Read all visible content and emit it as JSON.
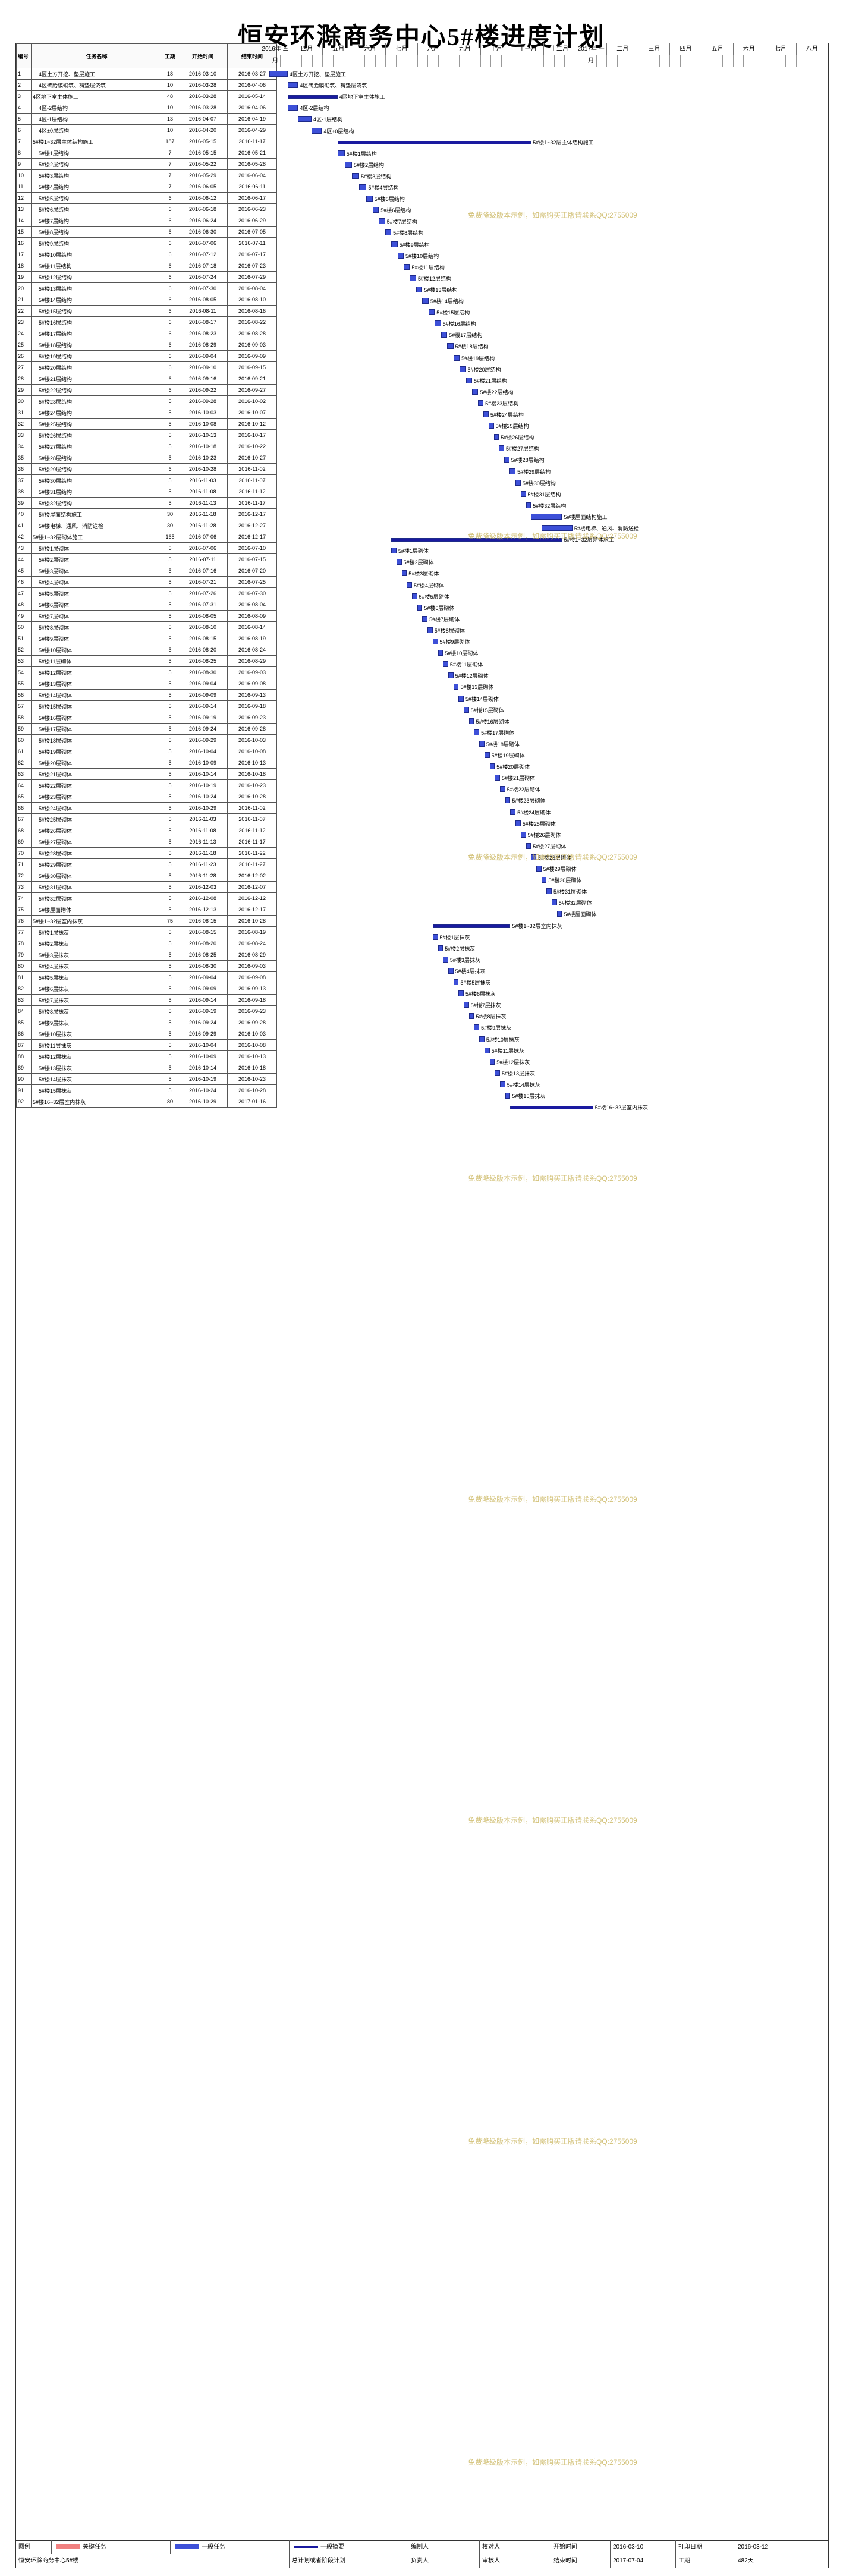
{
  "title": "恒安环滁商务中心5#楼进度计划",
  "table": {
    "headers": [
      "编号",
      "任务名称",
      "工期",
      "开始时间",
      "结束时间"
    ],
    "rows": [
      [
        "1",
        "4区土方开挖、垫层施工",
        "18",
        "2016-03-10",
        "2016-03-27"
      ],
      [
        "2",
        "4区砖胎膜砌筑、褥垫层浇筑",
        "10",
        "2016-03-28",
        "2016-04-06"
      ],
      [
        "3",
        "4区地下室主体施工",
        "48",
        "2016-03-28",
        "2016-05-14"
      ],
      [
        "4",
        "4区-2层结构",
        "10",
        "2016-03-28",
        "2016-04-06"
      ],
      [
        "5",
        "4区-1层结构",
        "13",
        "2016-04-07",
        "2016-04-19"
      ],
      [
        "6",
        "4区±0层结构",
        "10",
        "2016-04-20",
        "2016-04-29"
      ],
      [
        "7",
        "5#楼1~32层主体结构施工",
        "187",
        "2016-05-15",
        "2016-11-17"
      ],
      [
        "8",
        "5#楼1层结构",
        "7",
        "2016-05-15",
        "2016-05-21"
      ],
      [
        "9",
        "5#楼2层结构",
        "7",
        "2016-05-22",
        "2016-05-28"
      ],
      [
        "10",
        "5#楼3层结构",
        "7",
        "2016-05-29",
        "2016-06-04"
      ],
      [
        "11",
        "5#楼4层结构",
        "7",
        "2016-06-05",
        "2016-06-11"
      ],
      [
        "12",
        "5#楼5层结构",
        "6",
        "2016-06-12",
        "2016-06-17"
      ],
      [
        "13",
        "5#楼6层结构",
        "6",
        "2016-06-18",
        "2016-06-23"
      ],
      [
        "14",
        "5#楼7层结构",
        "6",
        "2016-06-24",
        "2016-06-29"
      ],
      [
        "15",
        "5#楼8层结构",
        "6",
        "2016-06-30",
        "2016-07-05"
      ],
      [
        "16",
        "5#楼9层结构",
        "6",
        "2016-07-06",
        "2016-07-11"
      ],
      [
        "17",
        "5#楼10层结构",
        "6",
        "2016-07-12",
        "2016-07-17"
      ],
      [
        "18",
        "5#楼11层结构",
        "6",
        "2016-07-18",
        "2016-07-23"
      ],
      [
        "19",
        "5#楼12层结构",
        "6",
        "2016-07-24",
        "2016-07-29"
      ],
      [
        "20",
        "5#楼13层结构",
        "6",
        "2016-07-30",
        "2016-08-04"
      ],
      [
        "21",
        "5#楼14层结构",
        "6",
        "2016-08-05",
        "2016-08-10"
      ],
      [
        "22",
        "5#楼15层结构",
        "6",
        "2016-08-11",
        "2016-08-16"
      ],
      [
        "23",
        "5#楼16层结构",
        "6",
        "2016-08-17",
        "2016-08-22"
      ],
      [
        "24",
        "5#楼17层结构",
        "6",
        "2016-08-23",
        "2016-08-28"
      ],
      [
        "25",
        "5#楼18层结构",
        "6",
        "2016-08-29",
        "2016-09-03"
      ],
      [
        "26",
        "5#楼19层结构",
        "6",
        "2016-09-04",
        "2016-09-09"
      ],
      [
        "27",
        "5#楼20层结构",
        "6",
        "2016-09-10",
        "2016-09-15"
      ],
      [
        "28",
        "5#楼21层结构",
        "6",
        "2016-09-16",
        "2016-09-21"
      ],
      [
        "29",
        "5#楼22层结构",
        "6",
        "2016-09-22",
        "2016-09-27"
      ],
      [
        "30",
        "5#楼23层结构",
        "5",
        "2016-09-28",
        "2016-10-02"
      ],
      [
        "31",
        "5#楼24层结构",
        "5",
        "2016-10-03",
        "2016-10-07"
      ],
      [
        "32",
        "5#楼25层结构",
        "5",
        "2016-10-08",
        "2016-10-12"
      ],
      [
        "33",
        "5#楼26层结构",
        "5",
        "2016-10-13",
        "2016-10-17"
      ],
      [
        "34",
        "5#楼27层结构",
        "5",
        "2016-10-18",
        "2016-10-22"
      ],
      [
        "35",
        "5#楼28层结构",
        "5",
        "2016-10-23",
        "2016-10-27"
      ],
      [
        "36",
        "5#楼29层结构",
        "6",
        "2016-10-28",
        "2016-11-02"
      ],
      [
        "37",
        "5#楼30层结构",
        "5",
        "2016-11-03",
        "2016-11-07"
      ],
      [
        "38",
        "5#楼31层结构",
        "5",
        "2016-11-08",
        "2016-11-12"
      ],
      [
        "39",
        "5#楼32层结构",
        "5",
        "2016-11-13",
        "2016-11-17"
      ],
      [
        "40",
        "5#楼屋面结构施工",
        "30",
        "2016-11-18",
        "2016-12-17"
      ],
      [
        "41",
        "5#楼电梯、通风、消防送检",
        "30",
        "2016-11-28",
        "2016-12-27"
      ],
      [
        "42",
        "5#楼1~32层砌体施工",
        "165",
        "2016-07-06",
        "2016-12-17"
      ],
      [
        "43",
        "5#楼1层砌体",
        "5",
        "2016-07-06",
        "2016-07-10"
      ],
      [
        "44",
        "5#楼2层砌体",
        "5",
        "2016-07-11",
        "2016-07-15"
      ],
      [
        "45",
        "5#楼3层砌体",
        "5",
        "2016-07-16",
        "2016-07-20"
      ],
      [
        "46",
        "5#楼4层砌体",
        "5",
        "2016-07-21",
        "2016-07-25"
      ],
      [
        "47",
        "5#楼5层砌体",
        "5",
        "2016-07-26",
        "2016-07-30"
      ],
      [
        "48",
        "5#楼6层砌体",
        "5",
        "2016-07-31",
        "2016-08-04"
      ],
      [
        "49",
        "5#楼7层砌体",
        "5",
        "2016-08-05",
        "2016-08-09"
      ],
      [
        "50",
        "5#楼8层砌体",
        "5",
        "2016-08-10",
        "2016-08-14"
      ],
      [
        "51",
        "5#楼9层砌体",
        "5",
        "2016-08-15",
        "2016-08-19"
      ],
      [
        "52",
        "5#楼10层砌体",
        "5",
        "2016-08-20",
        "2016-08-24"
      ],
      [
        "53",
        "5#楼11层砌体",
        "5",
        "2016-08-25",
        "2016-08-29"
      ],
      [
        "54",
        "5#楼12层砌体",
        "5",
        "2016-08-30",
        "2016-09-03"
      ],
      [
        "55",
        "5#楼13层砌体",
        "5",
        "2016-09-04",
        "2016-09-08"
      ],
      [
        "56",
        "5#楼14层砌体",
        "5",
        "2016-09-09",
        "2016-09-13"
      ],
      [
        "57",
        "5#楼15层砌体",
        "5",
        "2016-09-14",
        "2016-09-18"
      ],
      [
        "58",
        "5#楼16层砌体",
        "5",
        "2016-09-19",
        "2016-09-23"
      ],
      [
        "59",
        "5#楼17层砌体",
        "5",
        "2016-09-24",
        "2016-09-28"
      ],
      [
        "60",
        "5#楼18层砌体",
        "5",
        "2016-09-29",
        "2016-10-03"
      ],
      [
        "61",
        "5#楼19层砌体",
        "5",
        "2016-10-04",
        "2016-10-08"
      ],
      [
        "62",
        "5#楼20层砌体",
        "5",
        "2016-10-09",
        "2016-10-13"
      ],
      [
        "63",
        "5#楼21层砌体",
        "5",
        "2016-10-14",
        "2016-10-18"
      ],
      [
        "64",
        "5#楼22层砌体",
        "5",
        "2016-10-19",
        "2016-10-23"
      ],
      [
        "65",
        "5#楼23层砌体",
        "5",
        "2016-10-24",
        "2016-10-28"
      ],
      [
        "66",
        "5#楼24层砌体",
        "5",
        "2016-10-29",
        "2016-11-02"
      ],
      [
        "67",
        "5#楼25层砌体",
        "5",
        "2016-11-03",
        "2016-11-07"
      ],
      [
        "68",
        "5#楼26层砌体",
        "5",
        "2016-11-08",
        "2016-11-12"
      ],
      [
        "69",
        "5#楼27层砌体",
        "5",
        "2016-11-13",
        "2016-11-17"
      ],
      [
        "70",
        "5#楼28层砌体",
        "5",
        "2016-11-18",
        "2016-11-22"
      ],
      [
        "71",
        "5#楼29层砌体",
        "5",
        "2016-11-23",
        "2016-11-27"
      ],
      [
        "72",
        "5#楼30层砌体",
        "5",
        "2016-11-28",
        "2016-12-02"
      ],
      [
        "73",
        "5#楼31层砌体",
        "5",
        "2016-12-03",
        "2016-12-07"
      ],
      [
        "74",
        "5#楼32层砌体",
        "5",
        "2016-12-08",
        "2016-12-12"
      ],
      [
        "75",
        "5#楼屋面砌体",
        "5",
        "2016-12-13",
        "2016-12-17"
      ],
      [
        "76",
        "5#楼1~32层室内抹灰",
        "75",
        "2016-08-15",
        "2016-10-28"
      ],
      [
        "77",
        "5#楼1层抹灰",
        "5",
        "2016-08-15",
        "2016-08-19"
      ],
      [
        "78",
        "5#楼2层抹灰",
        "5",
        "2016-08-20",
        "2016-08-24"
      ],
      [
        "79",
        "5#楼3层抹灰",
        "5",
        "2016-08-25",
        "2016-08-29"
      ],
      [
        "80",
        "5#楼4层抹灰",
        "5",
        "2016-08-30",
        "2016-09-03"
      ],
      [
        "81",
        "5#楼5层抹灰",
        "5",
        "2016-09-04",
        "2016-09-08"
      ],
      [
        "82",
        "5#楼6层抹灰",
        "5",
        "2016-09-09",
        "2016-09-13"
      ],
      [
        "83",
        "5#楼7层抹灰",
        "5",
        "2016-09-14",
        "2016-09-18"
      ],
      [
        "84",
        "5#楼8层抹灰",
        "5",
        "2016-09-19",
        "2016-09-23"
      ],
      [
        "85",
        "5#楼9层抹灰",
        "5",
        "2016-09-24",
        "2016-09-28"
      ],
      [
        "86",
        "5#楼10层抹灰",
        "5",
        "2016-09-29",
        "2016-10-03"
      ],
      [
        "87",
        "5#楼11层抹灰",
        "5",
        "2016-10-04",
        "2016-10-08"
      ],
      [
        "88",
        "5#楼12层抹灰",
        "5",
        "2016-10-09",
        "2016-10-13"
      ],
      [
        "89",
        "5#楼13层抹灰",
        "5",
        "2016-10-14",
        "2016-10-18"
      ],
      [
        "90",
        "5#楼14层抹灰",
        "5",
        "2016-10-19",
        "2016-10-23"
      ],
      [
        "91",
        "5#楼15层抹灰",
        "5",
        "2016-10-24",
        "2016-10-28"
      ],
      [
        "92",
        "5#楼16~32层室内抹灰",
        "80",
        "2016-10-29",
        "2017-01-16"
      ]
    ]
  },
  "gantt": {
    "months": [
      "2016年 三月",
      "四月",
      "五月",
      "六月",
      "七月",
      "八月",
      "九月",
      "十月",
      "十一月",
      "十二月",
      "2017年 一月",
      "二月",
      "三月",
      "四月",
      "五月",
      "六月",
      "七月",
      "八月"
    ],
    "summary_rows": [
      3,
      7,
      42,
      76,
      92
    ]
  },
  "watermark": "免费降级版本示例，如需购买正版请联系QQ:2755009",
  "footer": {
    "legend_label": "图例",
    "key_task": "关键任务",
    "normal_task": "一般任务",
    "summary_task": "一般摘要",
    "project_label": "恒安环滁商务中心5#楼",
    "cell_plan": "总计划或者阶段计划",
    "editor_label": "编制人",
    "reviewer_label": "校对人",
    "approver_label": "负责人",
    "auditor_label": "审核人",
    "start_label": "开始时间",
    "start_value": "2016-03-10",
    "end_label": "结束时间",
    "end_value": "2017-07-04",
    "print_label": "打印日期",
    "print_value": "2016-03-12",
    "duration_label": "工期",
    "duration_value": "482天"
  }
}
